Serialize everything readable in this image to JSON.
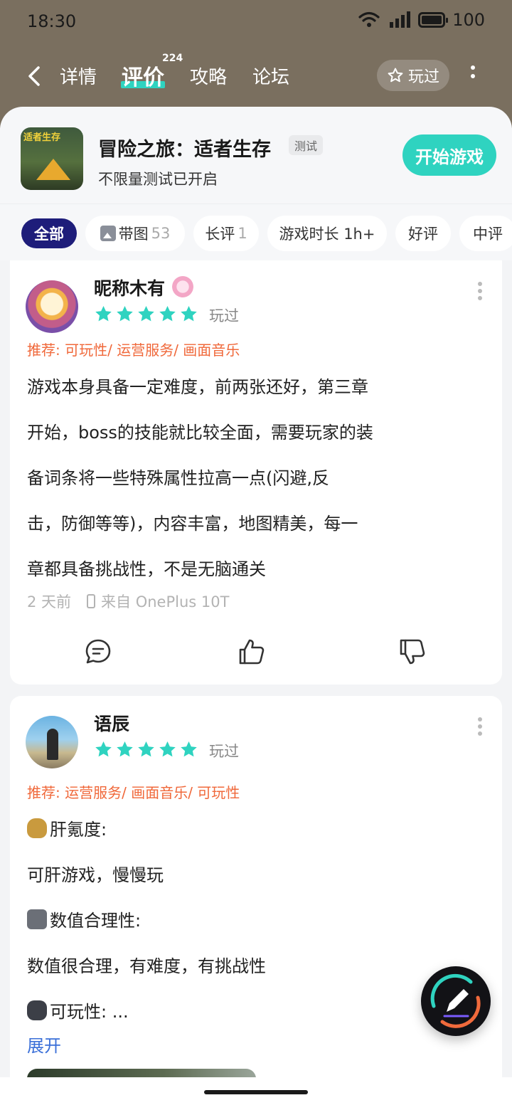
{
  "status_bar": {
    "time": "18:30",
    "battery": "100"
  },
  "nav": {
    "tabs": [
      "详情",
      "评价",
      "攻略",
      "论坛"
    ],
    "active_tab": "评价",
    "review_count_badge": "224",
    "played_label": "玩过"
  },
  "game": {
    "icon_text": "适者生存",
    "title": "冒险之旅：适者生存",
    "tag": "测试",
    "subtitle": "不限量测试已开启",
    "start_button": "开始游戏"
  },
  "filters": [
    {
      "label": "全部",
      "count": "",
      "active": true
    },
    {
      "label": "带图",
      "count": "53",
      "icon": "image-icon"
    },
    {
      "label": "长评",
      "count": "1"
    },
    {
      "label": "游戏时长 1h+",
      "count": ""
    },
    {
      "label": "好评",
      "count": ""
    },
    {
      "label": "中评",
      "count": ""
    }
  ],
  "reviews": [
    {
      "username": "昵称木有",
      "rating": 5,
      "status": "玩过",
      "recommend": "推荐: 可玩性/ 运营服务/ 画面音乐",
      "lines": [
        "游戏本身具备一定难度，前两张还好，第三章",
        "开始，boss的技能就比较全面，需要玩家的装",
        "备词条将一些特殊属性拉高一点(闪避,反",
        "击，防御等等)，内容丰富，地图精美，每一",
        "章都具备挑战性，不是无脑通关"
      ],
      "time": "2 天前",
      "device": "来自 OnePlus 10T"
    },
    {
      "username": "语辰",
      "rating": 5,
      "status": "玩过",
      "recommend": "推荐: 运营服务/ 画面音乐/ 可玩性",
      "lines": [
        "肝氪度:",
        "可肝游戏，慢慢玩",
        "数值合理性:",
        "数值很合理，有难度，有挑战性",
        "可玩性:  ..."
      ],
      "expand": "展开"
    }
  ],
  "colors": {
    "accent": "#2fd3c0",
    "header": "#7a6f5f",
    "recommend": "#f0683a",
    "active_chip": "#1e1d7a",
    "link": "#3a6fd8"
  }
}
